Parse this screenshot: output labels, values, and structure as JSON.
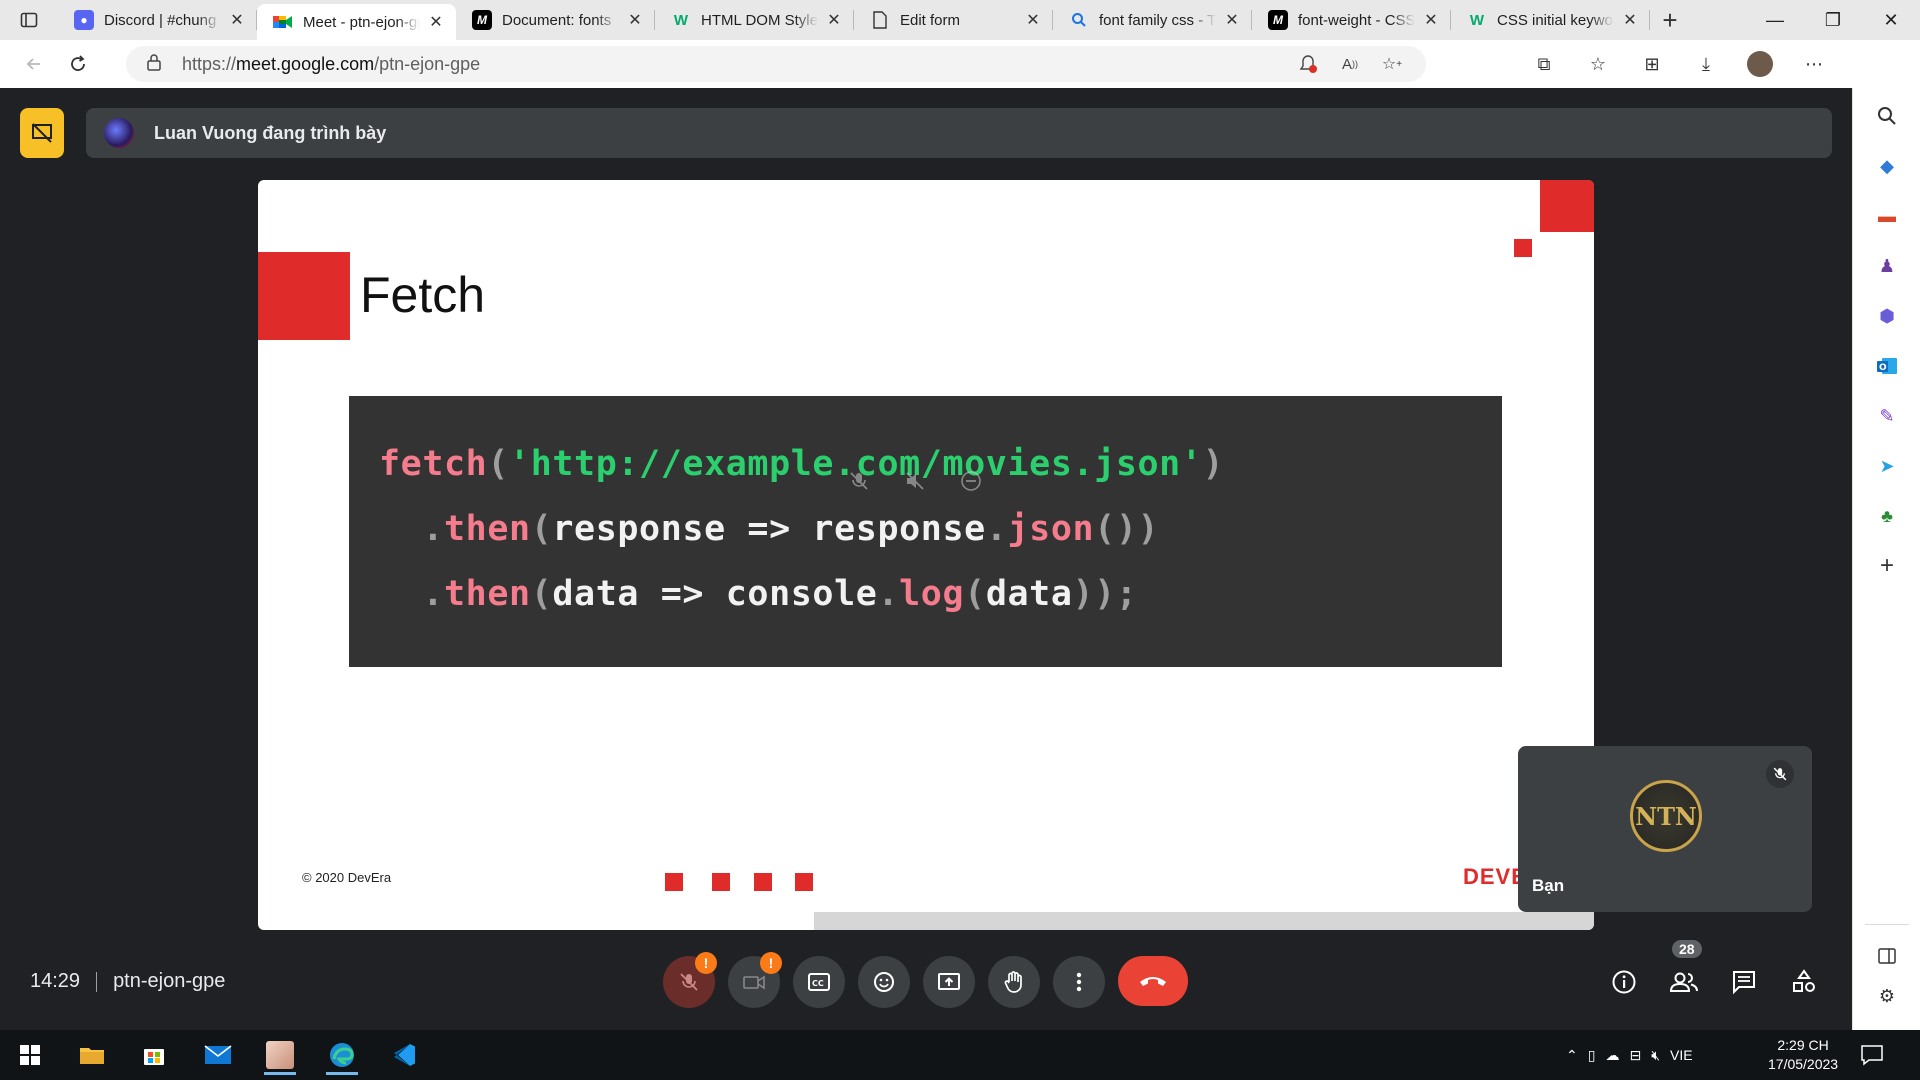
{
  "browser": {
    "tabs": [
      {
        "title": "Discord | #chung",
        "favicon": "discord-icon"
      },
      {
        "title": "Meet - ptn-ejon-gpe",
        "favicon": "google-meet-icon",
        "active": true
      },
      {
        "title": "Document: fonts",
        "favicon": "mdn-icon"
      },
      {
        "title": "HTML DOM Style",
        "favicon": "w3schools-icon"
      },
      {
        "title": "Edit form",
        "favicon": "document-icon"
      },
      {
        "title": "font family css - T",
        "favicon": "search-icon"
      },
      {
        "title": "font-weight - CSS",
        "favicon": "mdn-icon"
      },
      {
        "title": "CSS initial keywor",
        "favicon": "w3schools-icon"
      }
    ],
    "url": {
      "scheme": "https://",
      "host": "meet.google.com",
      "path": "/ptn-ejon-gpe"
    }
  },
  "presenter": {
    "text": "Luan Vuong đang trình bày"
  },
  "slide": {
    "title": "Fetch",
    "code": {
      "l1": {
        "fn": "fetch",
        "p1": "(",
        "str": "'http://example.com/movies.json'",
        "p2": ")"
      },
      "l2": {
        "dot": ".",
        "fn": "then",
        "p1": "(",
        "t1": "response => response",
        "dot2": ".",
        "fn2": "json",
        "p2": "())"
      },
      "l3": {
        "dot": ".",
        "fn": "then",
        "p1": "(",
        "t1": "data => console",
        "dot2": ".",
        "fn2": "log",
        "p2": "(",
        "t2": "data",
        "p3": "));"
      }
    },
    "footer": "© 2020 DevEra",
    "brand_partial": "DEVE"
  },
  "self_tile": {
    "name": "Bạn",
    "logo_text": "NTN"
  },
  "meeting": {
    "time": "14:29",
    "code": "ptn-ejon-gpe"
  },
  "participants_count": "28",
  "taskbar": {
    "language": "VIE",
    "time": "2:29 CH",
    "date": "17/05/2023"
  },
  "colors": {
    "accent_red": "#e02b2b",
    "leave_red": "#ea4335",
    "present_yellow": "#f6c026",
    "code_bg": "#333333",
    "code_fn": "#f47c8c",
    "code_str": "#2bcf6e"
  }
}
